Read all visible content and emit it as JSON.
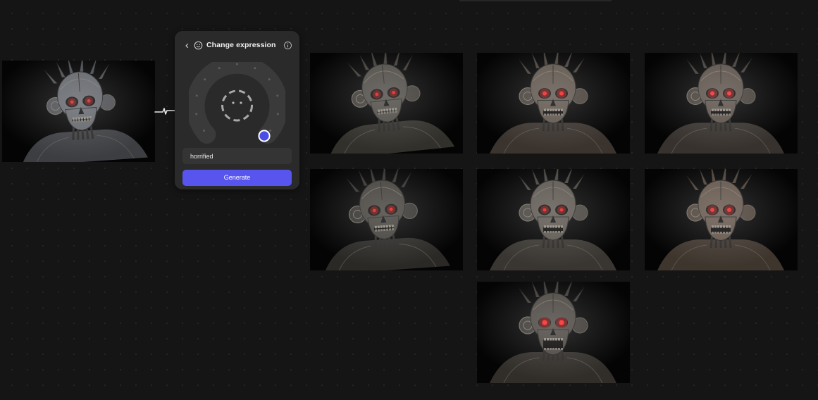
{
  "panel": {
    "title": "Change expression",
    "back_icon": "chevron-left-icon",
    "title_icon": "smiley-face-icon",
    "info_icon": "info-icon",
    "expression_value": "horrified",
    "generate_label": "Generate",
    "accent_color": "#5855ee"
  },
  "source_image": {
    "icon": "cyborg-skull-portrait-source"
  },
  "results": [
    {
      "icon": "cyborg-skull-variant-1"
    },
    {
      "icon": "cyborg-skull-variant-2"
    },
    {
      "icon": "cyborg-skull-variant-3"
    },
    {
      "icon": "cyborg-skull-variant-4"
    },
    {
      "icon": "cyborg-skull-variant-5"
    },
    {
      "icon": "cyborg-skull-variant-6"
    },
    {
      "icon": "cyborg-skull-variant-7-horrified"
    }
  ]
}
